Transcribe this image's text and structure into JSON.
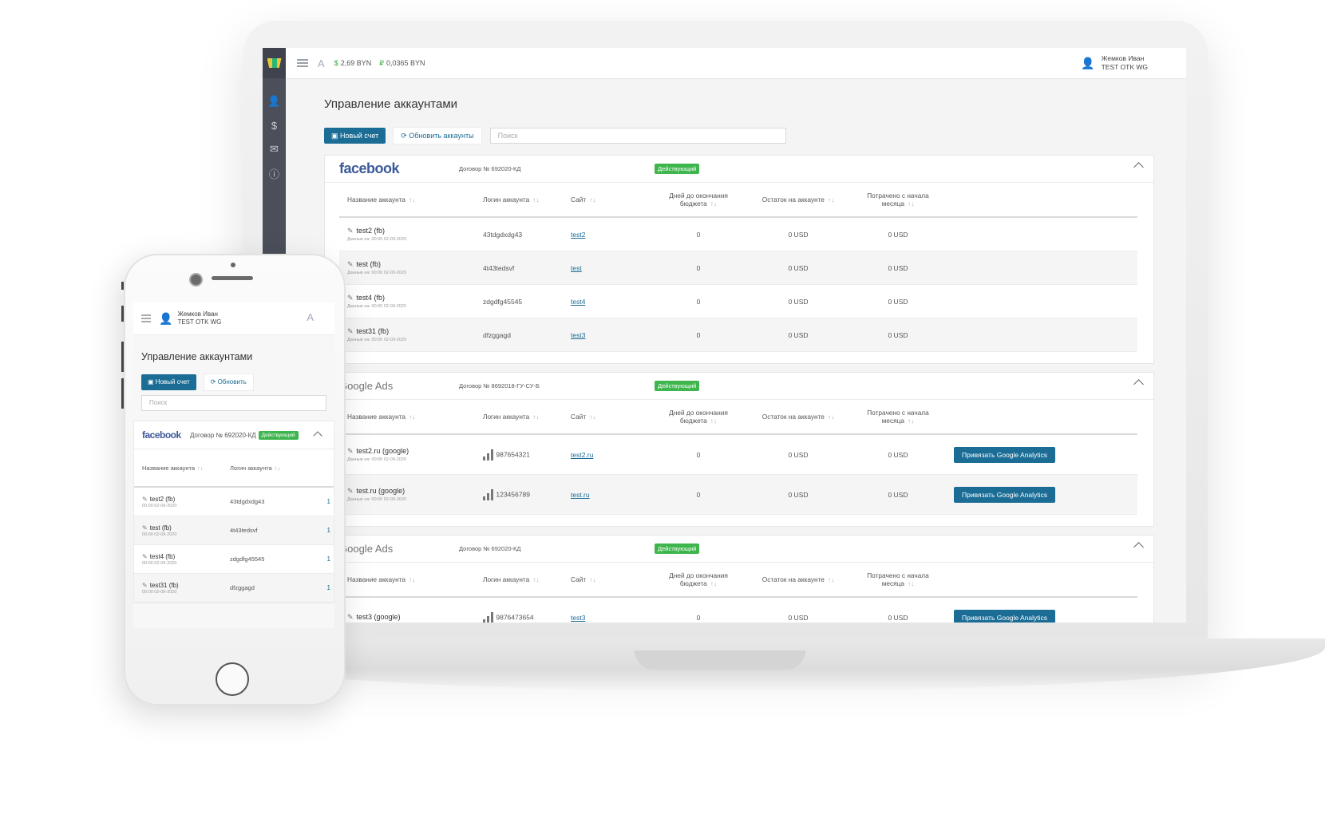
{
  "desktop": {
    "topbar": {
      "lang_icon": "A",
      "balance_usd": "2,69 BYN",
      "balance_rub": "0,0365 BYN",
      "user_name": "Жемков Иван",
      "user_org": "TEST OTK WG"
    },
    "page_title": "Управление аккаунтами",
    "new_account_button": "Новый счет",
    "refresh_button": "Обновить аккаунты",
    "search_placeholder": "Поиск",
    "columns": {
      "name": "Название аккаунта",
      "login": "Логин аккаунта",
      "site": "Сайт",
      "days": "Дней до окончания бюджета",
      "balance": "Остаток на аккаунте",
      "spent": "Потрачено с начала месяца"
    },
    "sort_icon": "↑↓",
    "cards": [
      {
        "brand": "facebook",
        "contract": "Договор № 692020-КД",
        "status": "Действующий",
        "rows": [
          {
            "name": "test2 (fb)",
            "sub": "Данные на: 00:00 02-09-2020",
            "login": "43tdgdxdg43",
            "site": "test2",
            "days": "0",
            "balance": "0 USD",
            "spent": "0 USD"
          },
          {
            "name": "test (fb)",
            "sub": "Данные на: 00:00 02-09-2020",
            "login": "4t43tedsvf",
            "site": "test",
            "days": "0",
            "balance": "0 USD",
            "spent": "0 USD"
          },
          {
            "name": "test4 (fb)",
            "sub": "Данные на: 00:00 02-09-2020",
            "login": "zdgdfg45545",
            "site": "test4",
            "days": "0",
            "balance": "0 USD",
            "spent": "0 USD"
          },
          {
            "name": "test31 (fb)",
            "sub": "Данные на: 00:00 02-09-2020",
            "login": "dfzggagd",
            "site": "test3",
            "days": "0",
            "balance": "0 USD",
            "spent": "0 USD"
          }
        ]
      },
      {
        "brand": "Google Ads",
        "contract": "Договор № 8692018-ГУ-СУ-Б",
        "status": "Действующий",
        "rows": [
          {
            "name": "test2.ru (google)",
            "sub": "Данные на: 00:00 02-09-2020",
            "login": "987654321",
            "site": "test2.ru",
            "days": "0",
            "balance": "0 USD",
            "spent": "0 USD",
            "action": "Привязать Google Analytics"
          },
          {
            "name": "test.ru (google)",
            "sub": "Данные на: 00:00 02-09-2020",
            "login": "123456789",
            "site": "test.ru",
            "days": "0",
            "balance": "0 USD",
            "spent": "0 USD",
            "action": "Привязать Google Analytics"
          }
        ]
      },
      {
        "brand": "Google Ads",
        "contract": "Договор № 692020-КД",
        "status": "Действующий",
        "rows": [
          {
            "name": "test3 (google)",
            "sub": "",
            "login": "9876473654",
            "site": "test3",
            "days": "0",
            "balance": "0 USD",
            "spent": "0 USD",
            "action": "Привязать Google Analytics"
          }
        ]
      }
    ]
  },
  "mobile": {
    "user_name": "Жемков Иван",
    "user_org": "TEST OTK WG",
    "lang_icon": "A",
    "page_title": "Управление аккаунтами",
    "new_account_button": "Новый счет",
    "refresh_button": "Обновить",
    "search_placeholder": "Поиск",
    "brand": "facebook",
    "contract": "Договор № 692020-КД",
    "status": "Действующий",
    "col_name": "Название аккаунта",
    "col_login": "Логин аккаунта",
    "sort_icon": "↑↓",
    "rows": [
      {
        "name": "test2 (fb)",
        "sub": "00:00 02-09-2020",
        "login": "43tdgdxdg43",
        "cut": "1"
      },
      {
        "name": "test (fb)",
        "sub": "00:00 02-09-2020",
        "login": "4t43tedsvf",
        "cut": "1"
      },
      {
        "name": "test4 (fb)",
        "sub": "00:00 02-09-2020",
        "login": "zdgdfg45545",
        "cut": "1"
      },
      {
        "name": "test31 (fb)",
        "sub": "00:00 02-09-2020",
        "login": "dfzggagd",
        "cut": "1"
      }
    ]
  }
}
